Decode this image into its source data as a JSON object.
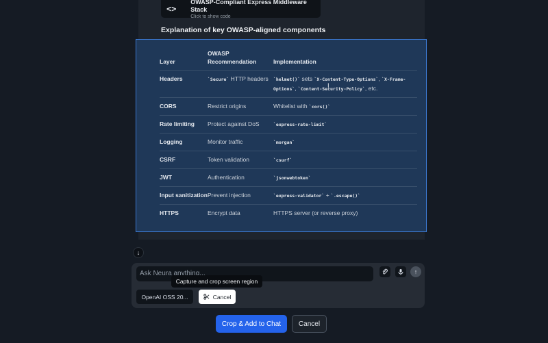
{
  "code_card": {
    "icon": "code-icon",
    "title": "OWASP-Compliant Express Middleware Stack",
    "subtitle": "Click to show code"
  },
  "section_heading": "Explanation of key OWASP-aligned components",
  "table": {
    "headers": [
      "Layer",
      "OWASP Recommendation",
      "Implementation"
    ],
    "rows": [
      {
        "layer": "Headers",
        "rec": "`Secure` HTTP headers",
        "impl": "`helmet()` sets `X-Content-Type-Options`, `X-Frame-Options`, `Content-Security-Policy`, etc."
      },
      {
        "layer": "CORS",
        "rec": "Restrict origins",
        "impl": "Whitelist with `cors()`"
      },
      {
        "layer": "Rate limiting",
        "rec": "Protect against DoS",
        "impl": "`express-rate-limit`"
      },
      {
        "layer": "Logging",
        "rec": "Monitor traffic",
        "impl": "`morgan`"
      },
      {
        "layer": "CSRF",
        "rec": "Token validation",
        "impl": "`csurf`"
      },
      {
        "layer": "JWT",
        "rec": "Authentication",
        "impl": "`jsonwebtoken`"
      },
      {
        "layer": "Input sanitization",
        "rec": "Prevent injection",
        "impl": "`express-validator` + `.escape()`"
      },
      {
        "layer": "HTTPS",
        "rec": "Encrypt data",
        "impl": "HTTPS server (or reverse proxy)"
      }
    ]
  },
  "composer": {
    "placeholder": "Ask Neura anything...",
    "model_label": "OpenAI OSS 20...",
    "cancel_chip_label": "Cancel"
  },
  "tooltip": "Capture and crop screen region",
  "actions": {
    "crop_label": "Crop & Add to Chat",
    "cancel_label": "Cancel"
  },
  "colors": {
    "accent": "#2463eb",
    "selection_border": "#3d7bd6",
    "selection_fill": "#1f3858"
  }
}
